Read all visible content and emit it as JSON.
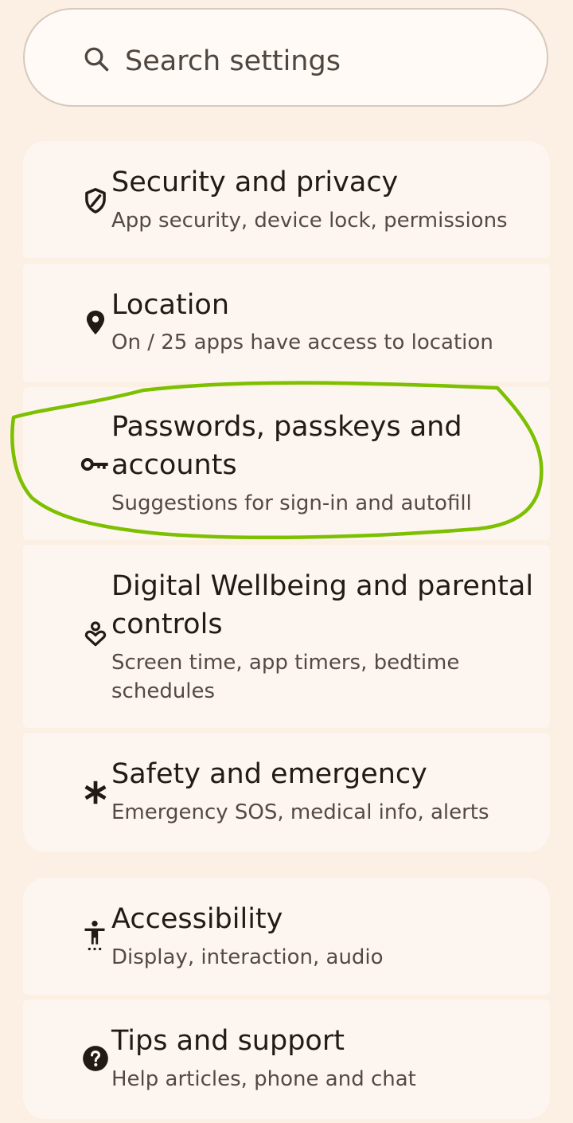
{
  "search": {
    "placeholder": "Search settings",
    "icon": "search-icon"
  },
  "items": [
    {
      "id": "security",
      "title": "Security and privacy",
      "subtitle": "App security, device lock, permissions",
      "icon": "shield-icon"
    },
    {
      "id": "location",
      "title": "Location",
      "subtitle": "On / 25 apps have access to location",
      "icon": "location-pin-icon"
    },
    {
      "id": "passwords",
      "title": "Passwords, passkeys and accounts",
      "subtitle": "Suggestions for sign-in and autofill",
      "icon": "key-icon"
    },
    {
      "id": "wellbeing",
      "title": "Digital Wellbeing and parental controls",
      "subtitle": "Screen time, app timers, bedtime schedules",
      "icon": "wellbeing-icon"
    },
    {
      "id": "safety",
      "title": "Safety and emergency",
      "subtitle": "Emergency SOS, medical info, alerts",
      "icon": "asterisk-icon"
    },
    {
      "id": "accessibility",
      "title": "Accessibility",
      "subtitle": "Display, interaction, audio",
      "icon": "accessibility-icon"
    },
    {
      "id": "tips",
      "title": "Tips and support",
      "subtitle": "Help articles, phone and chat",
      "icon": "help-icon"
    }
  ],
  "colors": {
    "background": "#fcefe3",
    "card": "#fdf6f0",
    "annotation": "#7cc000"
  }
}
